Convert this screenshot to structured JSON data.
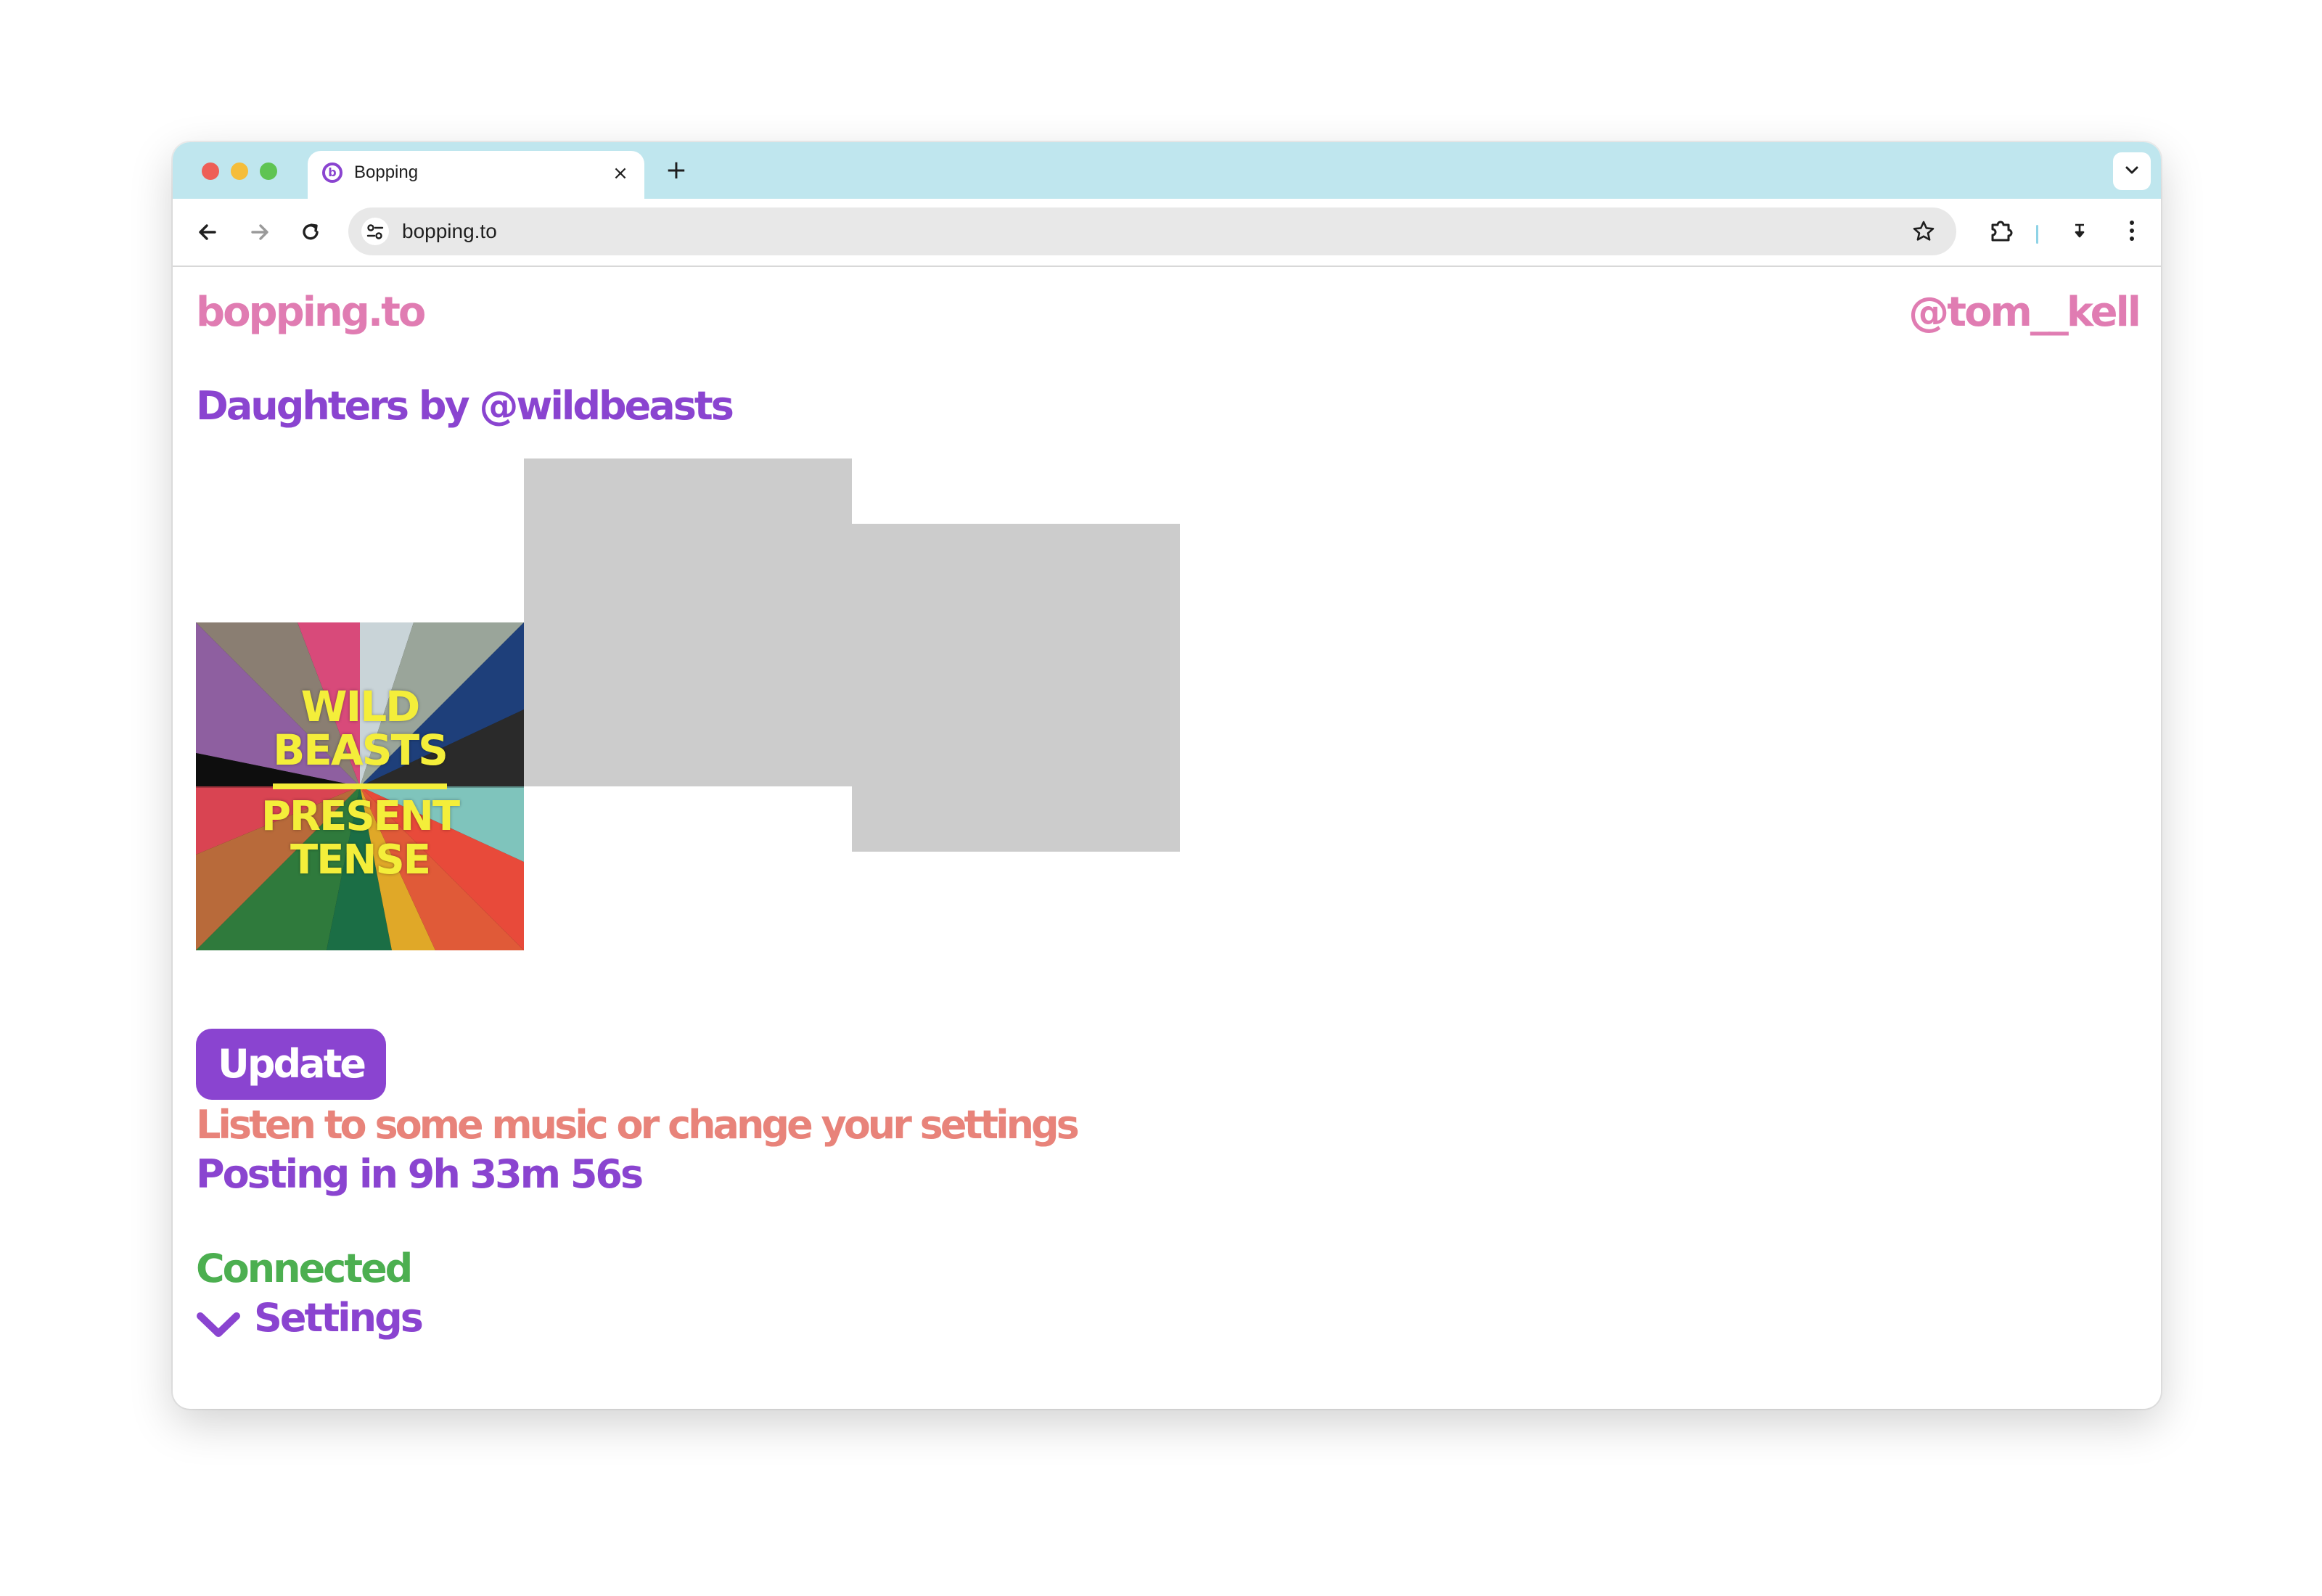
{
  "browser": {
    "tab_title": "Bopping",
    "favicon_letter": "b",
    "close_glyph": "×",
    "new_tab_glyph": "+",
    "url": "bopping.to"
  },
  "header": {
    "brand": "bopping.to",
    "username": "@tom__kell"
  },
  "now_playing": {
    "title": "Daughters by @wildbeasts"
  },
  "album_art": {
    "cover_line_1": "WILD",
    "cover_line_2": "BEASTS",
    "cover_line_3": "PRESENT",
    "cover_line_4": "TENSE",
    "placeholder_color": "#cccccc"
  },
  "actions": {
    "update_label": "Update"
  },
  "info": {
    "hint": "Listen to some music or change your settings",
    "posting": "Posting in 9h 33m 56s"
  },
  "connection": {
    "status": "Connected",
    "settings_label": "Settings"
  },
  "colors": {
    "brand_pink": "#e07cb2",
    "purple": "#8a44d0",
    "salmon": "#e8837a",
    "green": "#4caf50",
    "tabstrip": "#bfe6ee"
  },
  "icons": {
    "back": "arrow-left-icon",
    "forward": "arrow-right-icon",
    "reload": "reload-icon",
    "site_info": "tune-icon",
    "bookmark": "star-icon",
    "extensions": "puzzle-icon",
    "menu": "kebab-menu-icon",
    "settings_toggle": "chevron-down-icon"
  }
}
